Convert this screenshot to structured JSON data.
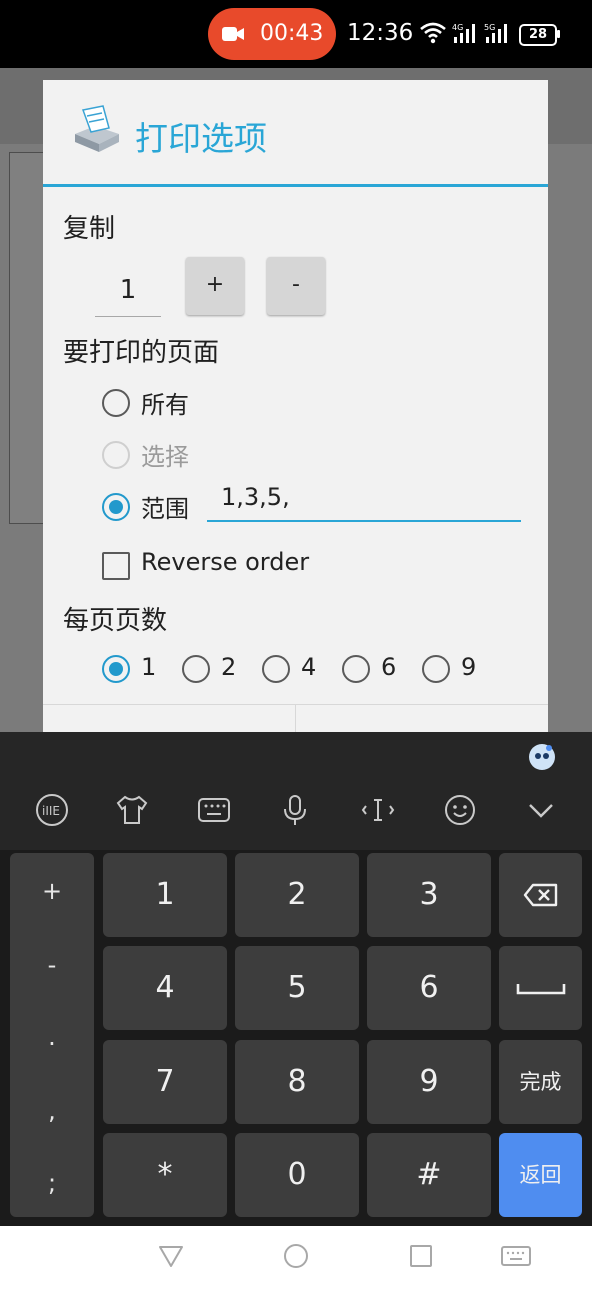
{
  "status_bar": {
    "recording_time": "00:43",
    "clock": "12:36",
    "battery": "28",
    "icons": [
      "video-camera-icon",
      "wifi-icon",
      "signal-4g-icon",
      "signal-5g-icon",
      "battery-icon"
    ]
  },
  "dialog": {
    "title": "打印选项",
    "copies": {
      "label": "复制",
      "value": "1",
      "plus_label": "+",
      "minus_label": "-"
    },
    "pages": {
      "label": "要打印的页面",
      "options": [
        {
          "label": "所有",
          "checked": false,
          "enabled": true
        },
        {
          "label": "选择",
          "checked": false,
          "enabled": false
        },
        {
          "label": "范围",
          "checked": true,
          "enabled": true
        }
      ],
      "range_value": "1,3,5,",
      "reverse_order_label": "Reverse order",
      "reverse_order_checked": false
    },
    "pages_per_sheet": {
      "label": "每页页数",
      "options": [
        "1",
        "2",
        "4",
        "6",
        "9"
      ],
      "selected": "1"
    }
  },
  "keyboard": {
    "side_keys": [
      "+",
      "-",
      ".",
      ",",
      ";"
    ],
    "rows": [
      [
        "1",
        "2",
        "3"
      ],
      [
        "4",
        "5",
        "6"
      ],
      [
        "7",
        "8",
        "9"
      ],
      [
        "*",
        "0",
        "#"
      ]
    ],
    "done_label": "完成",
    "return_label": "返回",
    "accent_color": "#4f8df0"
  },
  "colors": {
    "accent": "#2aa6d6",
    "recording": "#e84a2b"
  }
}
